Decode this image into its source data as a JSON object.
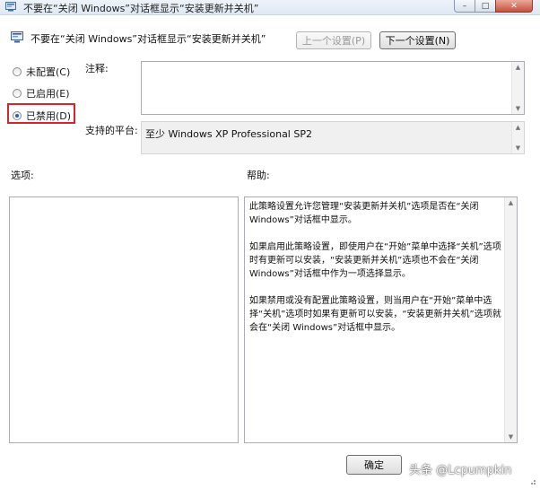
{
  "window": {
    "title": "不要在“关闭 Windows”对话框显示“安装更新并关机”",
    "controls": {
      "minimize": "–",
      "maximize": "□",
      "close": "✕"
    }
  },
  "header": {
    "title": "不要在“关闭 Windows”对话框显示“安装更新并关机”",
    "prev_button": "上一个设置(P)",
    "next_button": "下一个设置(N)"
  },
  "state_options": [
    {
      "label": "未配置(C)",
      "selected": false
    },
    {
      "label": "已启用(E)",
      "selected": false
    },
    {
      "label": "已禁用(D)",
      "selected": true
    }
  ],
  "comment": {
    "label": "注释:",
    "value": ""
  },
  "platform": {
    "label": "支持的平台:",
    "value": "至少 Windows XP Professional SP2"
  },
  "options": {
    "label": "选项:"
  },
  "help": {
    "label": "帮助:",
    "paragraphs": [
      "此策略设置允许您管理“安装更新并关机”选项是否在“关闭 Windows”对话框中显示。",
      "如果启用此策略设置，即使用户在“开始”菜单中选择“关机”选项时有更新可以安装，“安装更新并关机”选项也不会在“关闭 Windows”对话框中作为一项选择显示。",
      "如果禁用或没有配置此策略设置，则当用户在“开始”菜单中选择“关机”选项时如果有更新可以安装，“安装更新并关机”选项就会在“关闭 Windows”对话框中显示。"
    ]
  },
  "footer": {
    "ok_button": "确定"
  },
  "watermark": "头条 @Lcpumpkin",
  "colors": {
    "highlight_border": "#d8232a",
    "radio_dot": "#2a5bb8"
  },
  "icons": {
    "window_icon": "policy-settings-icon",
    "header_icon": "policy-settings-icon",
    "scroll_up": "chevron-up-icon",
    "scroll_down": "chevron-down-icon"
  }
}
